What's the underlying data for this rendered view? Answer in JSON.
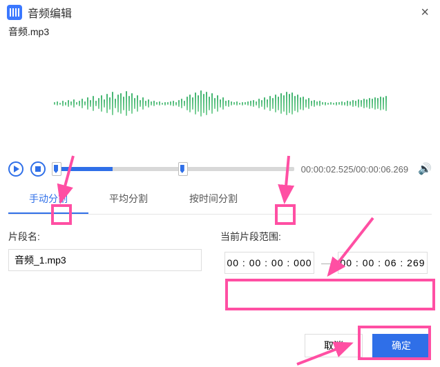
{
  "titlebar": {
    "title": "音频编辑"
  },
  "filename": "音频.mp3",
  "player": {
    "current_time": "00:00:02.525",
    "total_time": "00:00:06.269"
  },
  "tabs": {
    "items": [
      {
        "label": "手动分割"
      },
      {
        "label": "平均分割"
      },
      {
        "label": "按时间分割"
      }
    ],
    "active_index": 0
  },
  "segment": {
    "name_label": "片段名:",
    "name_value": "音频_1.mp3",
    "range_label": "当前片段范围:",
    "start": "00 : 00 : 00 : 000",
    "end": "00 : 00 : 06 : 269"
  },
  "buttons": {
    "cancel": "取消",
    "ok": "确定"
  }
}
